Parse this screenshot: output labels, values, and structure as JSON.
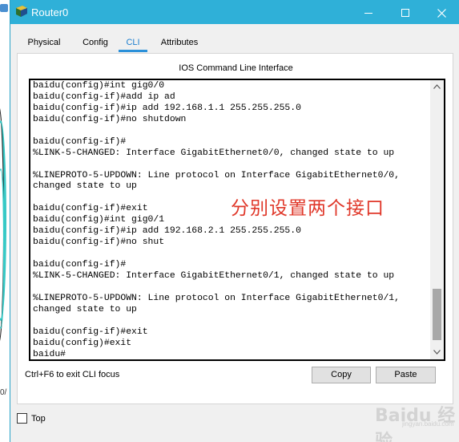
{
  "window": {
    "title": "Router0"
  },
  "tabs": [
    {
      "label": "Physical"
    },
    {
      "label": "Config"
    },
    {
      "label": "CLI"
    },
    {
      "label": "Attributes"
    }
  ],
  "active_tab": "CLI",
  "panel": {
    "heading": "IOS Command Line Interface"
  },
  "terminal": {
    "lines": [
      "baidu(config)#int gig0/0",
      "baidu(config-if)#add ip ad",
      "baidu(config-if)#ip add 192.168.1.1 255.255.255.0",
      "baidu(config-if)#no shutdown",
      "",
      "baidu(config-if)#",
      "%LINK-5-CHANGED: Interface GigabitEthernet0/0, changed state to up",
      "",
      "%LINEPROTO-5-UPDOWN: Line protocol on Interface GigabitEthernet0/0,",
      "changed state to up",
      "",
      "baidu(config-if)#exit",
      "baidu(config)#int gig0/1",
      "baidu(config-if)#ip add 192.168.2.1 255.255.255.0",
      "baidu(config-if)#no shut",
      "",
      "baidu(config-if)#",
      "%LINK-5-CHANGED: Interface GigabitEthernet0/1, changed state to up",
      "",
      "%LINEPROTO-5-UPDOWN: Line protocol on Interface GigabitEthernet0/1,",
      "changed state to up",
      "",
      "baidu(config-if)#exit",
      "baidu(config)#exit",
      "baidu#"
    ],
    "annotation": "分别设置两个接口"
  },
  "footer": {
    "hint": "Ctrl+F6 to exit CLI focus",
    "copy_label": "Copy",
    "paste_label": "Paste"
  },
  "bottom": {
    "top_label": "Top",
    "top_checked": false
  },
  "background": {
    "edge_text": "0/"
  },
  "watermark": {
    "text": "Baidu 经验",
    "sub": "jingyan.baidu.com"
  },
  "colors": {
    "titlebar": "#2fb0d8",
    "active_tab": "#2b90d9",
    "annotation": "#e0382a"
  },
  "icons": {
    "app": "packet-tracer-router-icon",
    "minimize": "minimize-icon",
    "maximize": "maximize-icon",
    "close": "close-icon",
    "scroll_up": "chevron-up-icon",
    "scroll_down": "chevron-down-icon"
  }
}
